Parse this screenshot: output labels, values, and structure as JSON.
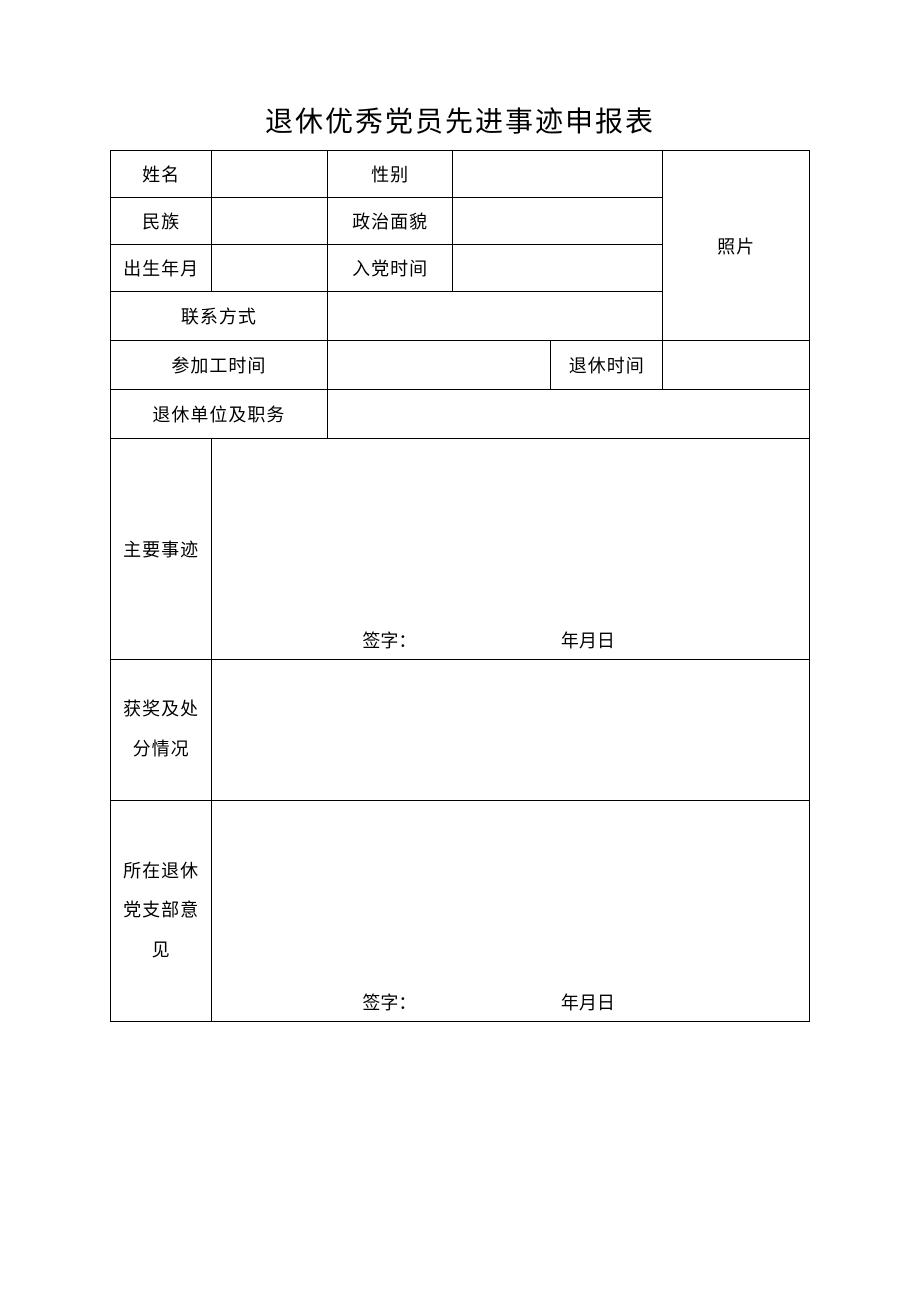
{
  "title": "退休优秀党员先进事迹申报表",
  "fields": {
    "name": "姓名",
    "gender": "性别",
    "ethnicity": "民族",
    "political": "政治面貌",
    "birth": "出生年月",
    "joinParty": "入党时间",
    "photo": "照片",
    "contact": "联系方式",
    "workStart": "参加工时间",
    "retireTime": "退休时间",
    "retireUnit": "退休单位及职务",
    "deeds": "主要事迹",
    "awards": "获奖及处分情况",
    "branchOpinion": "所在退休党支部意见"
  },
  "signature": {
    "label": "签字：",
    "date": "年月日"
  }
}
